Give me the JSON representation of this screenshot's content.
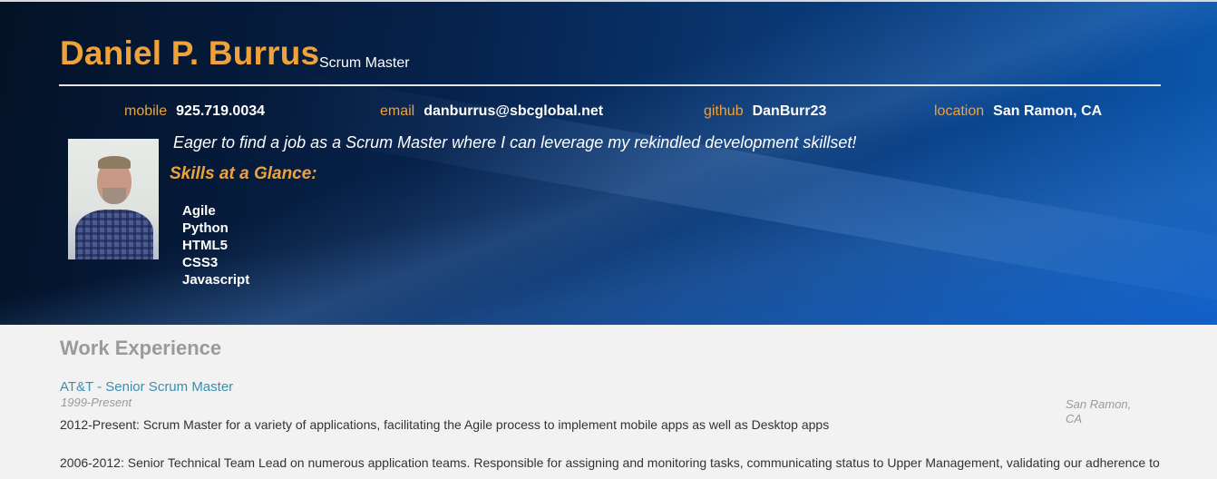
{
  "header": {
    "name": "Daniel P. Burrus",
    "role": "Scrum Master",
    "contacts": [
      {
        "label": "mobile",
        "value": "925.719.0034"
      },
      {
        "label": "email",
        "value": "danburrus@sbcglobal.net"
      },
      {
        "label": "github",
        "value": "DanBurr23"
      },
      {
        "label": "location",
        "value": "San Ramon, CA"
      }
    ],
    "tagline": "Eager to find a job as a Scrum Master where I can leverage my rekindled development skillset!",
    "skills_title": "Skills at a Glance:",
    "skills": [
      "Agile",
      "Python",
      "HTML5",
      "CSS3",
      "Javascript"
    ]
  },
  "work": {
    "section_title": "Work Experience",
    "jobs": [
      {
        "title": "AT&T - Senior Scrum Master",
        "dates": "1999-Present",
        "location": "San Ramon, CA",
        "paragraphs": [
          "2012-Present: Scrum Master for a variety of applications, facilitating the Agile process to implement mobile apps as well as Desktop apps",
          "2006-2012: Senior Technical Team Lead on numerous application teams. Responsible for assigning and monitoring tasks, communicating status to Upper Management, validating our adherence to"
        ]
      }
    ]
  },
  "colors": {
    "accent": "#f0a23a",
    "link": "#3a8fb0",
    "muted": "#9a9a9a",
    "header_dark": "#06214a",
    "header_light": "#0b58b0"
  }
}
